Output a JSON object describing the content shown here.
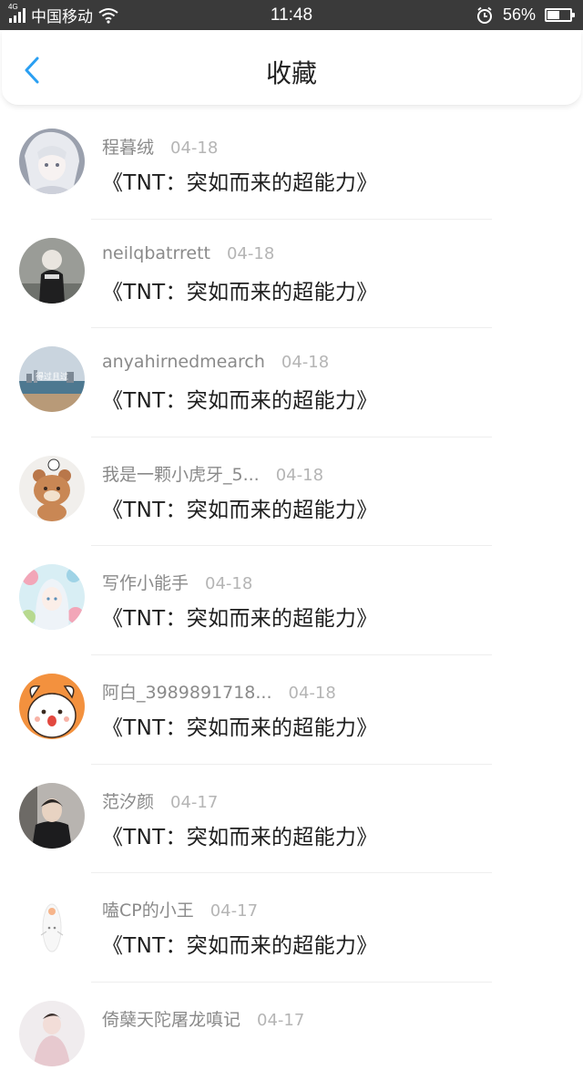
{
  "status_bar": {
    "network": "4G",
    "carrier": "中国移动",
    "time": "11:48",
    "battery_percent": "56%",
    "battery_level": 0.56,
    "icons": [
      "signal-icon",
      "wifi-icon",
      "alarm-icon",
      "battery-icon"
    ]
  },
  "header": {
    "title": "收藏",
    "back_icon": "chevron-left-icon",
    "accent_color": "#2a9ff2"
  },
  "items": [
    {
      "user": "程暮绒",
      "date": "04-18",
      "title": "《TNT：突如而来的超能力》"
    },
    {
      "user": "neilqbatrrett",
      "date": "04-18",
      "title": "《TNT：突如而来的超能力》"
    },
    {
      "user": "anyahirnedmearch",
      "date": "04-18",
      "title": "《TNT：突如而来的超能力》",
      "avatar_caption": "得过且过"
    },
    {
      "user": "我是一颗小虎牙_5...",
      "date": "04-18",
      "title": "《TNT：突如而来的超能力》"
    },
    {
      "user": "写作小能手",
      "date": "04-18",
      "title": "《TNT：突如而来的超能力》"
    },
    {
      "user": "阿白_3989891718...",
      "date": "04-18",
      "title": "《TNT：突如而来的超能力》"
    },
    {
      "user": "范汐颜",
      "date": "04-17",
      "title": "《TNT：突如而来的超能力》"
    },
    {
      "user": "嗑CP的小王",
      "date": "04-17",
      "title": "《TNT：突如而来的超能力》"
    },
    {
      "user": "倚蘖天陀屠龙嗔记",
      "date": "04-17",
      "title": ""
    }
  ]
}
